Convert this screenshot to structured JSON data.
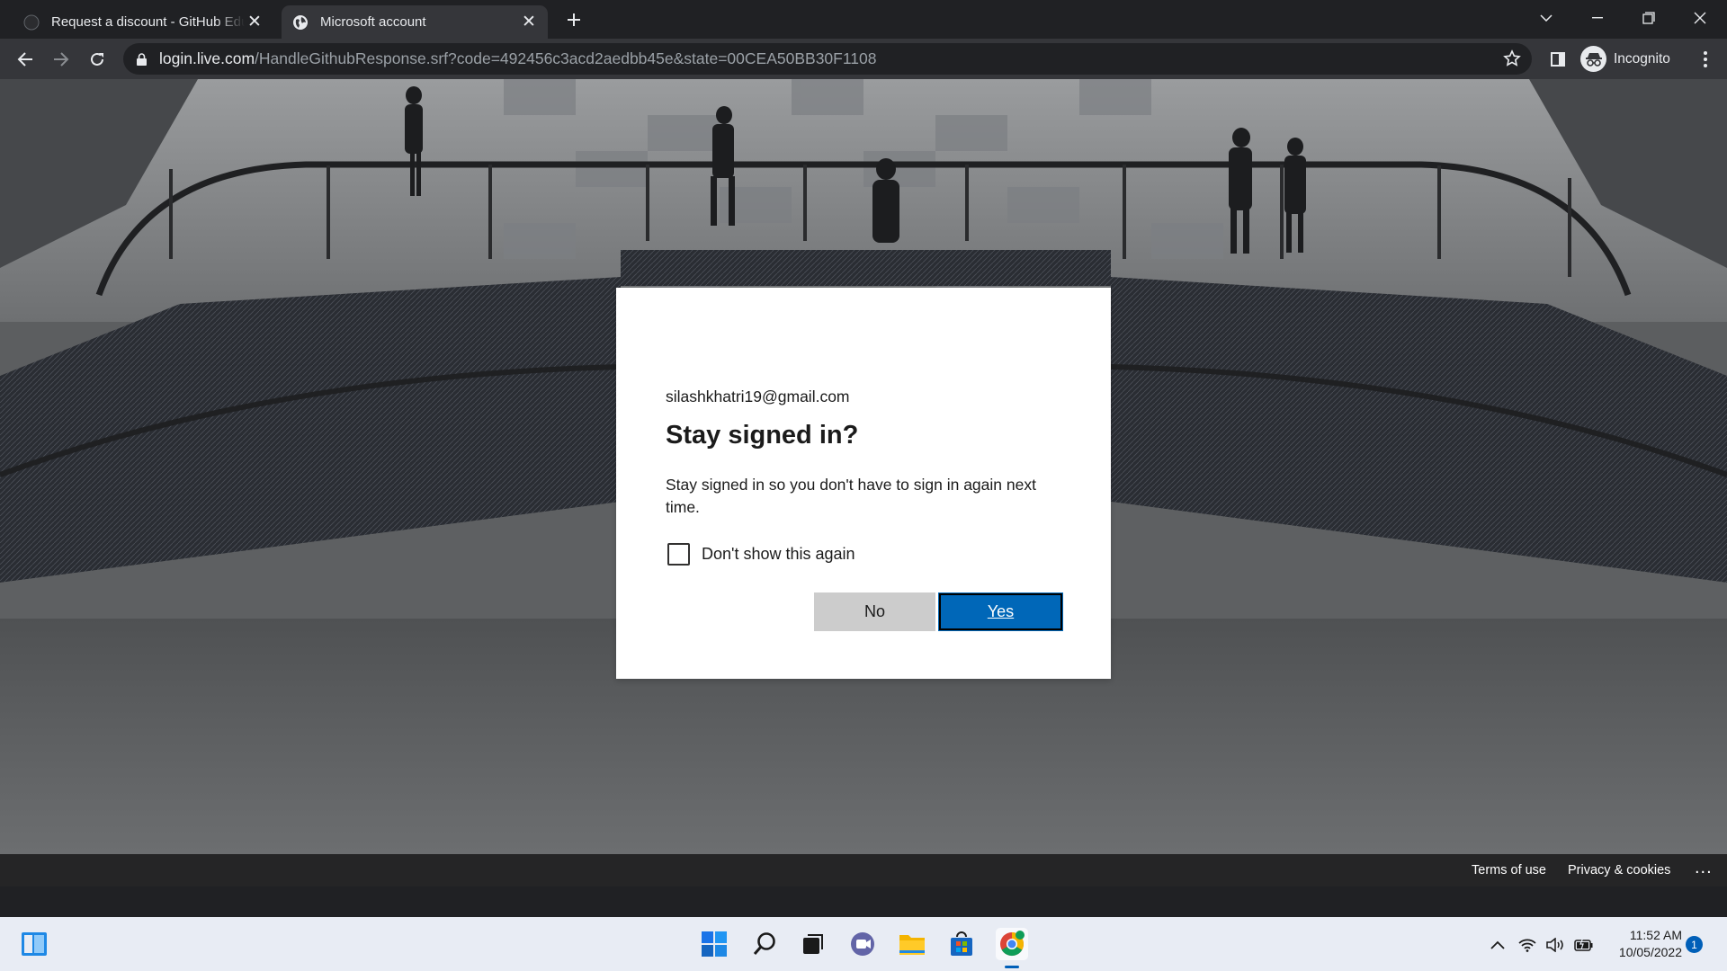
{
  "browser": {
    "tabs": [
      {
        "title": "Request a discount - GitHub Education",
        "favicon": "github-icon",
        "active": false
      },
      {
        "title": "Microsoft account",
        "favicon": "globe-icon",
        "active": true
      }
    ],
    "url_host": "login.live.com",
    "url_path": "/HandleGithubResponse.srf?code=492456c3acd2aedbb45e&state=00CEA50BB30F1108",
    "profile_label": "Incognito"
  },
  "dialog": {
    "identity": "silashkhatri19@gmail.com",
    "heading": "Stay signed in?",
    "description": "Stay signed in so you don't have to sign in again next time.",
    "checkbox_label": "Don't show this again",
    "checkbox_checked": false,
    "no_label": "No",
    "yes_label": "Yes",
    "accent_color": "#0067b8"
  },
  "footer": {
    "terms": "Terms of use",
    "privacy": "Privacy & cookies",
    "more": "..."
  },
  "taskbar": {
    "apps": [
      "start-icon",
      "search-icon",
      "task-view-icon",
      "teams-chat-icon",
      "file-explorer-icon",
      "microsoft-store-icon",
      "chrome-icon"
    ],
    "time": "11:52 AM",
    "date": "10/05/2022",
    "notification_count": "1"
  }
}
